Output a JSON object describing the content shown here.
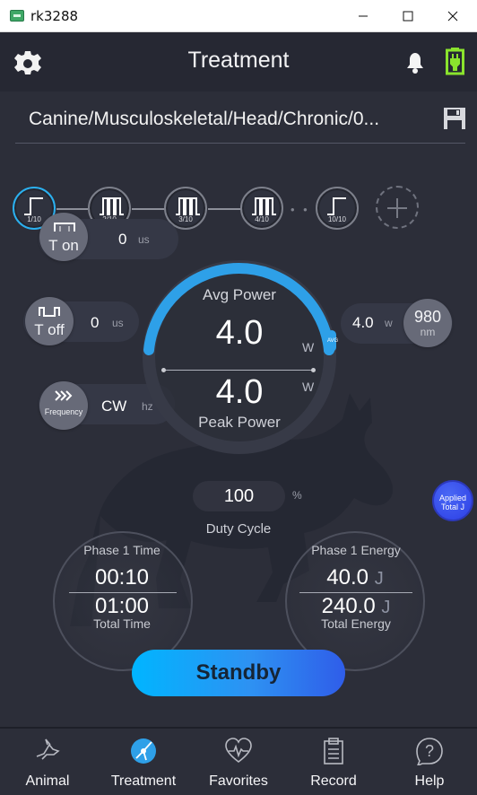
{
  "window": {
    "title": "rk3288"
  },
  "header": {
    "title": "Treatment",
    "icons": {
      "settings": "gear-icon",
      "alarm": "bell-icon",
      "power": "battery-icon"
    }
  },
  "protocol": {
    "path": "Canine/Musculoskeletal/Head/Chronic/0...",
    "save_icon": "save-icon"
  },
  "phases": [
    {
      "label": "1/10"
    },
    {
      "label": "2/10"
    },
    {
      "label": "3/10"
    },
    {
      "label": "4/10"
    },
    {
      "label": "10/10"
    }
  ],
  "parameters": {
    "t_on": {
      "label": "T on",
      "value": "0",
      "unit": "us"
    },
    "t_off": {
      "label": "T off",
      "value": "0",
      "unit": "us"
    },
    "frequency": {
      "label": "Frequency",
      "value": "CW",
      "unit": "hz"
    },
    "wavelength": {
      "power": "4.0",
      "power_unit": "w",
      "value": "980",
      "unit": "nm"
    }
  },
  "gauge": {
    "avg_label": "Avg Power",
    "avg_value": "4.0",
    "avg_unit": "W",
    "avg_badge": "AVG",
    "peak_value": "4.0",
    "peak_unit": "W",
    "peak_label": "Peak Power",
    "fill_fraction": 0.33
  },
  "duty_cycle": {
    "value": "100",
    "unit": "%",
    "label": "Duty Cycle"
  },
  "applied_energy": {
    "label_line1": "Applied",
    "label_line2": "Total J"
  },
  "time_panel": {
    "title": "Phase 1 Time",
    "phase_value": "00:10",
    "total_value": "01:00",
    "total_label": "Total Time"
  },
  "energy_panel": {
    "title": "Phase 1 Energy",
    "phase_value": "40.0",
    "phase_unit": "J",
    "total_value": "240.0",
    "total_unit": "J",
    "total_label": "Total Energy"
  },
  "action": {
    "label": "Standby"
  },
  "nav": [
    {
      "label": "Animal",
      "icon": "dog-head-icon"
    },
    {
      "label": "Treatment",
      "icon": "laser-icon"
    },
    {
      "label": "Favorites",
      "icon": "heart-pulse-icon"
    },
    {
      "label": "Record",
      "icon": "clipboard-icon"
    },
    {
      "label": "Help",
      "icon": "help-icon"
    }
  ],
  "colors": {
    "background": "#2c2e39",
    "accent": "#2bb0ef",
    "applied_button": "#3550f0"
  }
}
